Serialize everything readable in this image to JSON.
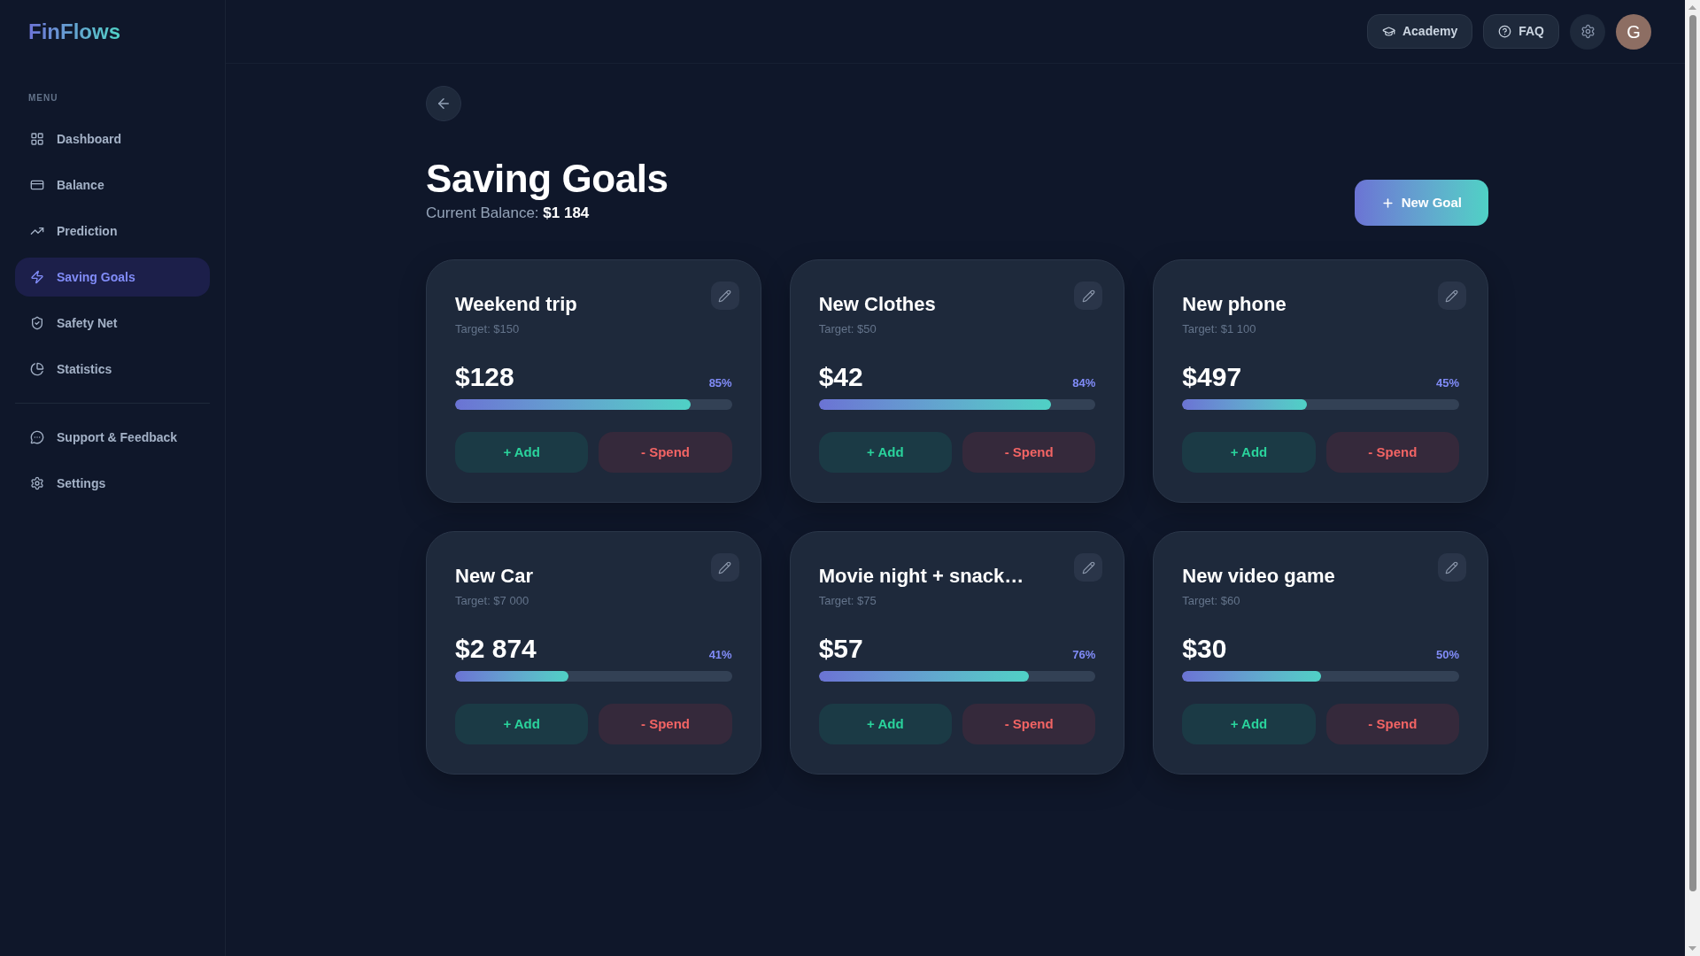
{
  "sidebar": {
    "logo": "FinFlows",
    "menu_heading": "MENU",
    "items": [
      {
        "label": "Dashboard",
        "selected": false
      },
      {
        "label": "Balance",
        "selected": false
      },
      {
        "label": "Prediction",
        "selected": false
      },
      {
        "label": "Saving Goals",
        "selected": true
      },
      {
        "label": "Safety Net",
        "selected": false
      },
      {
        "label": "Statistics",
        "selected": false
      }
    ],
    "footer_items": [
      {
        "label": "Support & Feedback",
        "selected": false
      },
      {
        "label": "Settings",
        "selected": false
      }
    ]
  },
  "header": {
    "buttons": [
      {
        "label": "Academy"
      },
      {
        "label": "FAQ"
      }
    ],
    "avatar_initial": "G"
  },
  "page": {
    "title": "Saving Goals",
    "balance_label": "Current Balance:",
    "balance_value": "$1 184",
    "new_goal_button": "New Goal"
  },
  "goals": [
    {
      "name": "Weekend trip",
      "target": "Target: $150",
      "amount": "$128",
      "percent": "85%",
      "level": 0.85,
      "add_label": "+ Add",
      "spend_label": "- Spend"
    },
    {
      "name": "New Clothes",
      "target": "Target: $50",
      "amount": "$42",
      "percent": "84%",
      "level": 0.84,
      "add_label": "+ Add",
      "spend_label": "- Spend"
    },
    {
      "name": "New phone",
      "target": "Target: $1 100",
      "amount": "$497",
      "percent": "45%",
      "level": 0.45,
      "add_label": "+ Add",
      "spend_label": "- Spend"
    },
    {
      "name": "New Car",
      "target": "Target: $7 000",
      "amount": "$2 874",
      "percent": "41%",
      "level": 0.41,
      "add_label": "+ Add",
      "spend_label": "- Spend"
    },
    {
      "name": "Movie night + snack…",
      "target": "Target: $75",
      "amount": "$57",
      "percent": "76%",
      "level": 0.76,
      "add_label": "+ Add",
      "spend_label": "- Spend"
    },
    {
      "name": "New video game",
      "target": "Target: $60",
      "amount": "$30",
      "percent": "50%",
      "level": 0.5,
      "add_label": "+ Add",
      "spend_label": "- Spend"
    }
  ]
}
